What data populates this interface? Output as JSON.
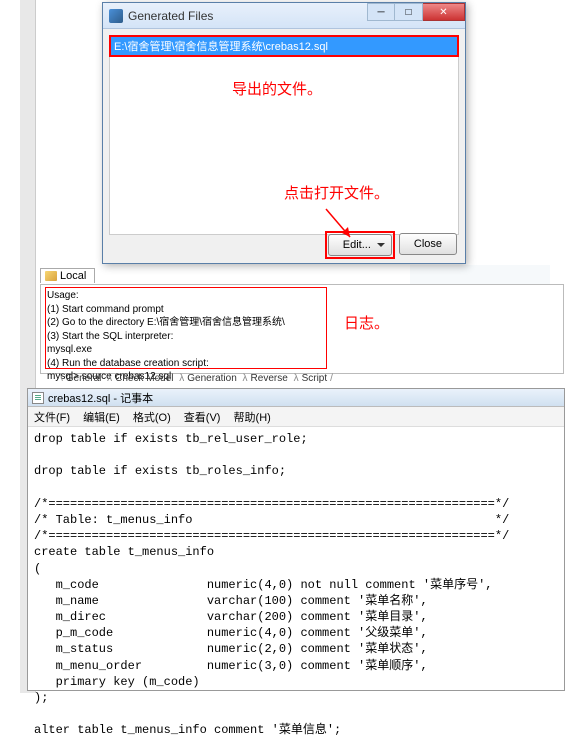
{
  "dialog": {
    "title": "Generated Files",
    "file_path": "E:\\宿舍管理\\宿舍信息管理系统\\crebas12.sql",
    "edit_label": "Edit...",
    "close_label": "Close"
  },
  "annotations": {
    "exported_file": "导出的文件。",
    "click_open": "点击打开文件。",
    "log": "日志。"
  },
  "local_tab": "Local",
  "log": {
    "usage": "Usage:",
    "line1": "   (1) Start command prompt",
    "line2": "   (2) Go to the directory E:\\宿舍管理\\宿舍信息管理系统\\",
    "line3": "   (3) Start the SQL interpreter:",
    "line4": "        mysql.exe",
    "line5": "   (4) Run the database creation script:",
    "line6": "        mysql> source crebas12.sql"
  },
  "footer_tabs": {
    "t1": "General",
    "t2": "Check Model",
    "t3": "Generation",
    "t4": "Reverse",
    "t5": "Script"
  },
  "notepad": {
    "title": "crebas12.sql - 记事本",
    "menu": {
      "file": "文件(F)",
      "edit": "编辑(E)",
      "format": "格式(O)",
      "view": "查看(V)",
      "help": "帮助(H)"
    },
    "content": "drop table if exists tb_rel_user_role;\n\ndrop table if exists tb_roles_info;\n\n/*==============================================================*/\n/* Table: t_menus_info                                          */\n/*==============================================================*/\ncreate table t_menus_info\n(\n   m_code               numeric(4,0) not null comment '菜单序号',\n   m_name               varchar(100) comment '菜单名称',\n   m_direc              varchar(200) comment '菜单目录',\n   p_m_code             numeric(4,0) comment '父级菜单',\n   m_status             numeric(2,0) comment '菜单状态',\n   m_menu_order         numeric(3,0) comment '菜单顺序',\n   primary key (m_code)\n);\n\nalter table t_menus_info comment '菜单信息';"
  }
}
